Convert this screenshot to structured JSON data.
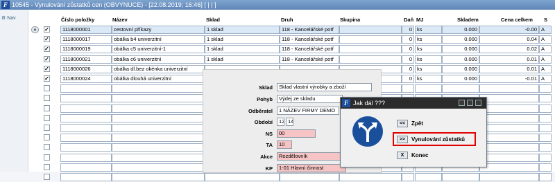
{
  "window": {
    "title": "10545 - Vynulování zůstatků cen (OBVYNUCE) - [22.08.2019; 16:46]  [ |  |  ]"
  },
  "nav": {
    "label": "Nav"
  },
  "columns": {
    "cislo": "Číslo položky",
    "nazev": "Název",
    "sklad": "Sklad",
    "druh": "Druh",
    "skupina": "Skupina",
    "dan": "Daň",
    "mj": "MJ",
    "skladem": "Skladem",
    "cena": "Cena celkem",
    "s": "S"
  },
  "rows": [
    {
      "checked": true,
      "cislo": "1118000001",
      "nazev": "cestovní příkazy",
      "sklad": "1 sklad",
      "druh": "118 - Kancelářské potř",
      "dan": "0",
      "mj": "ks",
      "skladem": "0.000",
      "cena": "-0.00",
      "s": "A"
    },
    {
      "checked": true,
      "cislo": "1118000017",
      "nazev": "obálka b4 univerzitní",
      "sklad": "1 sklad",
      "druh": "118 - Kancelářské potř",
      "dan": "0",
      "mj": "ks",
      "skladem": "0.000",
      "cena": "0.04",
      "s": "A"
    },
    {
      "checked": true,
      "cislo": "1118000019",
      "nazev": "obálka c5 univerzitní-1",
      "sklad": "1 sklad",
      "druh": "118 - Kancelářské potř",
      "dan": "0",
      "mj": "ks",
      "skladem": "0.000",
      "cena": "0.02",
      "s": "A"
    },
    {
      "checked": true,
      "cislo": "1118000021",
      "nazev": "obálka c6 univerzitní",
      "sklad": "1 sklad",
      "druh": "118 - Kancelářské potř",
      "dan": "0",
      "mj": "ks",
      "skladem": "0.000",
      "cena": "0.01",
      "s": "A"
    },
    {
      "checked": true,
      "cislo": "1118000026",
      "nazev": "obálka dl.bez okénka univerzitní",
      "sklad": "",
      "druh": "",
      "dan": "0",
      "mj": "ks",
      "skladem": "0.000",
      "cena": "0.01",
      "s": "A"
    },
    {
      "checked": true,
      "cislo": "1118000024",
      "nazev": "obálka dlouhá univerzitní",
      "sklad": "",
      "druh": "",
      "dan": "0",
      "mj": "ks",
      "skladem": "0.000",
      "cena": "-0.01",
      "s": "A"
    }
  ],
  "form": {
    "sklad_label": "Sklad",
    "sklad_value": "Sklad vlastní výrobky a zboží",
    "pohyb_label": "Pohyb",
    "pohyb_value": "Výdej ze skladu",
    "odberatel_label": "Odběratel",
    "odberatel_value": "1 NÁZEV FIRMY DEMO",
    "obdobi_label": "Období",
    "obdobi_month": "12",
    "obdobi_year": "14",
    "ns_label": "NS",
    "ns_value": "00",
    "ta_label": "TA",
    "ta_value": "10",
    "akce_label": "Akce",
    "akce_value": "Rozdělovník",
    "kp_label": "KP",
    "kp_value": "1-01 Hlavní činnost"
  },
  "dialog": {
    "title": "Jak dál ???",
    "back_key": "<<",
    "back_label": "Zpět",
    "next_key": ">>",
    "next_label": "Vynulování zůstatků",
    "close_key": "X",
    "close_label": "Konec"
  },
  "colors": {
    "titlebar": "#6f96c6",
    "dialog_titlebar": "#2b2b2b",
    "highlight": "#e00000",
    "sign": "#1a4f9c"
  }
}
